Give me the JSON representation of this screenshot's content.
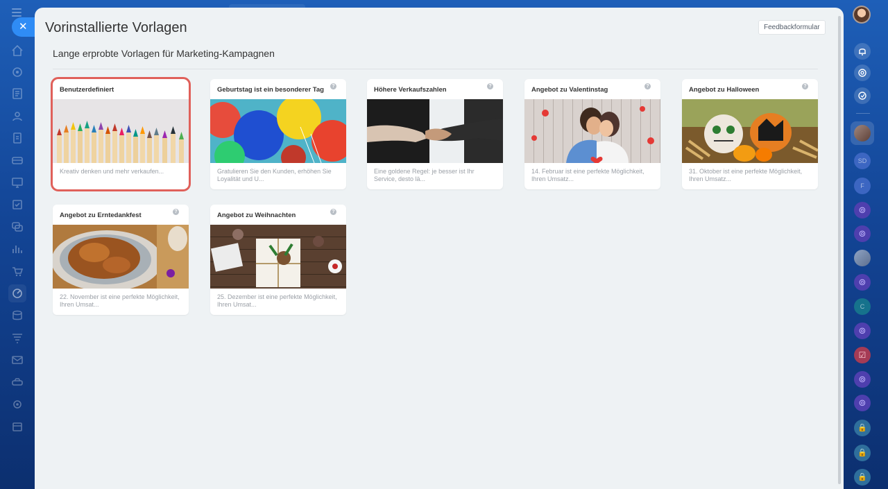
{
  "header": {
    "title": "Vorinstallierte Vorlagen",
    "feedback_label": "Feedbackformular"
  },
  "section": {
    "subtitle": "Lange erprobte Vorlagen für Marketing-Kampagnen"
  },
  "templates": [
    {
      "title": "Benutzerdefiniert",
      "desc": "Kreativ denken und mehr verkaufen...",
      "selected": true
    },
    {
      "title": "Geburtstag ist ein besonderer Tag",
      "desc": "Gratulieren Sie den Kunden, erhöhen Sie Loyalität und U..."
    },
    {
      "title": "Höhere Verkaufszahlen",
      "desc": "Eine goldene Regel: je besser ist Ihr Service, desto lä..."
    },
    {
      "title": "Angebot zu Valentinstag",
      "desc": "14. Februar ist eine perfekte Möglichkeit, Ihren Umsatz..."
    },
    {
      "title": "Angebot zu Halloween",
      "desc": "31. Oktober ist eine perfekte Möglichkeit, Ihren Umsatz..."
    },
    {
      "title": "Angebot zu Erntedankfest",
      "desc": "22. November ist eine perfekte Möglichkeit, Ihren Umsat..."
    },
    {
      "title": "Angebot zu Weihnachten",
      "desc": "25. Dezember ist eine perfekte Möglichkeit, Ihren Umsat..."
    }
  ],
  "help_glyph": "?",
  "close_glyph": "✕",
  "right_sidebar": {
    "initials_sd": "SD",
    "initials_f": "F",
    "initials_c": "C"
  },
  "icons": [
    "menu-icon",
    "close-icon",
    "home-icon",
    "feed-icon",
    "tasks-icon",
    "contacts-icon",
    "docs-icon",
    "crm-icon",
    "sites-icon",
    "check-icon",
    "chat-icon",
    "analytics-icon",
    "shop-icon",
    "marketing-icon",
    "bell-icon",
    "help-icon"
  ],
  "colors": {
    "accent": "#2f8cf5",
    "selected_outline": "#e0605a"
  }
}
